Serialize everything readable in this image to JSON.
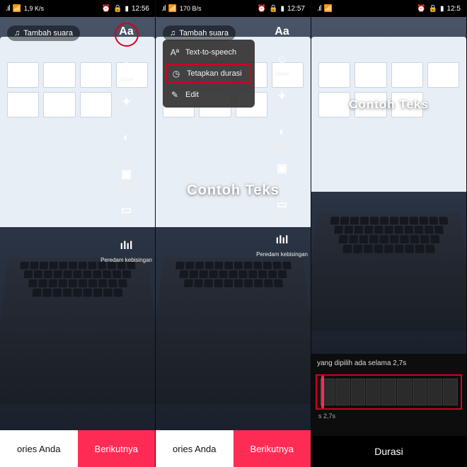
{
  "status": {
    "speed1": "1,9\nK/s",
    "speed2": "170\nB/s",
    "time1": "12:56",
    "time2": "12:57",
    "time3": "12:5"
  },
  "sound_pill": "Tambah suara",
  "tools": {
    "text": {
      "icon": "Aa",
      "label": "Teks"
    },
    "sticker": {
      "label": "Stiker"
    },
    "effects": {
      "label": "Efek"
    },
    "filter": {
      "label": "Filter"
    },
    "adjust": {
      "label": "Sesuaikan klip"
    },
    "subtitle": {
      "label": "Subtitle"
    },
    "noise": {
      "label": "Peredam kebisingan"
    }
  },
  "ctx": {
    "tts": "Text-to-speech",
    "duration": "Tetapkan durasi",
    "edit": "Edit"
  },
  "sample": "Contoh  Teks",
  "buttons": {
    "stories": "ories Anda",
    "next": "Berikutnya"
  },
  "dur": {
    "hint": "yang dipilih ada selama 2,7s",
    "time": "s 2,7s",
    "footer": "Durasi"
  }
}
